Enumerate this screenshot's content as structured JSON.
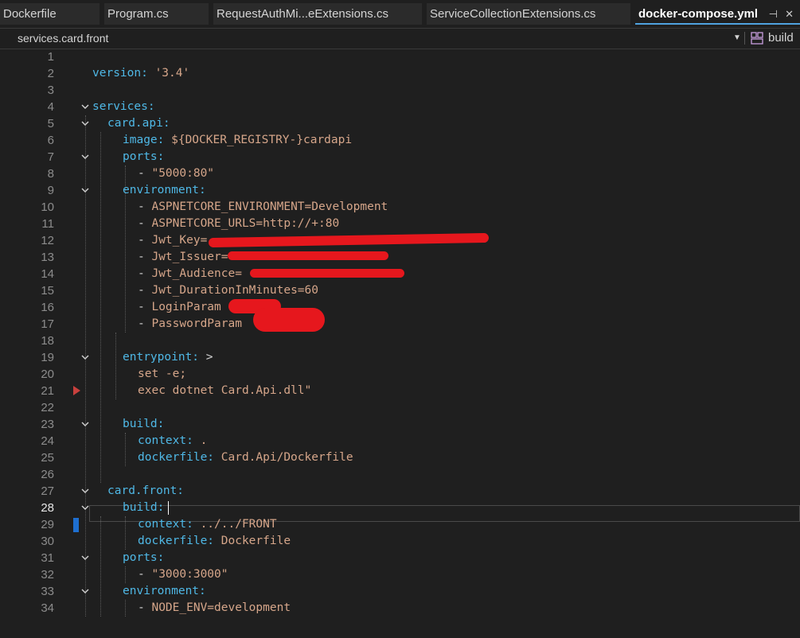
{
  "tabs": [
    {
      "label": "Dockerfile",
      "active": false
    },
    {
      "label": "Program.cs",
      "active": false
    },
    {
      "label": "RequestAuthMi...eExtensions.cs",
      "active": false
    },
    {
      "label": "ServiceCollectionExtensions.cs",
      "active": false
    },
    {
      "label": "docker-compose.yml",
      "active": true
    }
  ],
  "tab_icons": {
    "pin": "pin-icon",
    "close": "close-icon"
  },
  "navbar": {
    "scope": "services.card.front",
    "dropdown_icon": "chevron-down-icon",
    "member_icon": "structure-icon",
    "member": "build"
  },
  "editor": {
    "current_line": 28,
    "lines": [
      {
        "n": "1"
      },
      {
        "n": "2",
        "key": "version:",
        "val": " '3.4'"
      },
      {
        "n": "3"
      },
      {
        "n": "4",
        "key": "services:"
      },
      {
        "n": "5",
        "key": "card.api:"
      },
      {
        "n": "6",
        "key": "image:",
        "val": " ${DOCKER_REGISTRY-}cardapi"
      },
      {
        "n": "7",
        "key": "ports:"
      },
      {
        "n": "8",
        "punct": "- ",
        "val": "\"5000:80\""
      },
      {
        "n": "9",
        "key": "environment:"
      },
      {
        "n": "10",
        "punct": "- ",
        "val": "ASPNETCORE_ENVIRONMENT=Development"
      },
      {
        "n": "11",
        "punct": "- ",
        "val": "ASPNETCORE_URLS=http://+:80"
      },
      {
        "n": "12",
        "punct": "- ",
        "val": "Jwt_Key="
      },
      {
        "n": "13",
        "punct": "- ",
        "val": "Jwt_Issuer="
      },
      {
        "n": "14",
        "punct": "- ",
        "val": "Jwt_Audience="
      },
      {
        "n": "15",
        "punct": "- ",
        "val": "Jwt_DurationInMinutes=60"
      },
      {
        "n": "16",
        "punct": "- ",
        "val": "LoginParam"
      },
      {
        "n": "17",
        "punct": "- ",
        "val": "PasswordParam"
      },
      {
        "n": "18"
      },
      {
        "n": "19",
        "key": "entrypoint:",
        "punct": " >"
      },
      {
        "n": "20",
        "val": "set -e;"
      },
      {
        "n": "21",
        "val": "exec dotnet Card.Api.dll\""
      },
      {
        "n": "22"
      },
      {
        "n": "23",
        "key": "build:"
      },
      {
        "n": "24",
        "key": "context:",
        "val": " ."
      },
      {
        "n": "25",
        "key": "dockerfile:",
        "val": " Card.Api/Dockerfile"
      },
      {
        "n": "26"
      },
      {
        "n": "27",
        "key": "card.front:"
      },
      {
        "n": "28",
        "key": "build:"
      },
      {
        "n": "29",
        "key": "context:",
        "val": " ../../FRONT"
      },
      {
        "n": "30",
        "key": "dockerfile:",
        "val": " Dockerfile"
      },
      {
        "n": "31",
        "key": "ports:"
      },
      {
        "n": "32",
        "punct": "- ",
        "val": "\"3000:3000\""
      },
      {
        "n": "33",
        "key": "environment:"
      },
      {
        "n": "34",
        "punct": "- ",
        "val": "NODE_ENV=development"
      }
    ]
  },
  "colors": {
    "key": "#4fb8e6",
    "value": "#d6a68a",
    "redaction": "#e6171d",
    "active_tab_underline": "#4fa3e0"
  }
}
